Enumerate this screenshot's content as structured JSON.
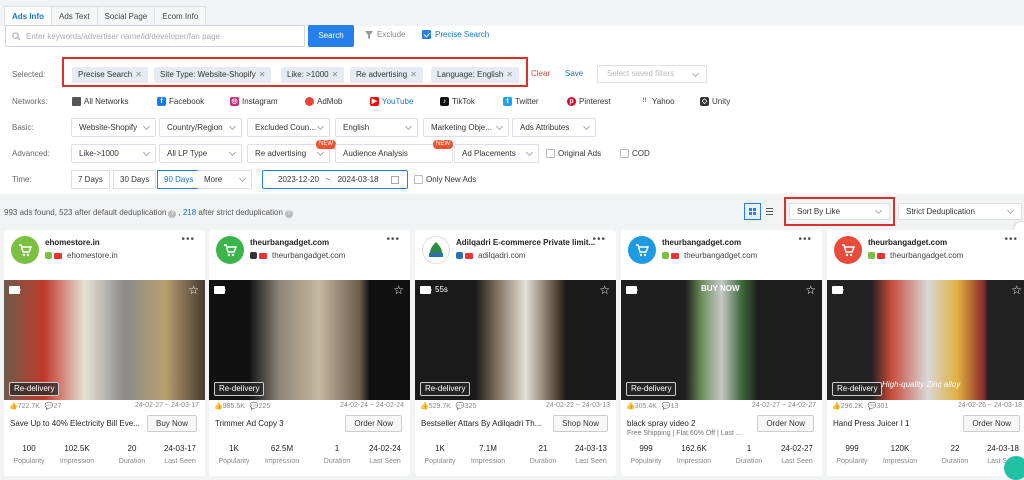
{
  "tabs": [
    "Ads Info",
    "Ads Text",
    "Social Page",
    "Ecom Info"
  ],
  "search": {
    "placeholder": "Enter keywords/advertiser name/id/developer/fan page",
    "button": "Search",
    "exclude": "Exclude",
    "precise": "Precise Search"
  },
  "selected": {
    "label": "Selected:",
    "chips": [
      "Precise Search",
      "Site Type: Website-Shopify",
      "Like: >1000",
      "Re advertising",
      "Language: English"
    ],
    "clear": "Clear",
    "save": "Save",
    "saved_placeholder": "Select saved filters"
  },
  "networks": {
    "label": "Networks:",
    "items": [
      "All Networks",
      "Facebook",
      "Instagram",
      "AdMob",
      "YouTube",
      "TikTok",
      "Twitter",
      "Pinterest",
      "Yahoo",
      "Unity"
    ]
  },
  "basic": {
    "label": "Basic:",
    "items": [
      "Website-Shopify",
      "Country/Region",
      "Excluded Coun...",
      "English",
      "Marketing Obje...",
      "Ads Attributes"
    ]
  },
  "advanced": {
    "label": "Advanced:",
    "items": [
      "Like->1000",
      "All LP Type",
      "Re advertising",
      "Audience Analysis",
      "Ad Placements"
    ],
    "new_badge": "NEW",
    "original_ads": "Original Ads",
    "cod": "COD"
  },
  "time": {
    "label": "Time:",
    "buttons": [
      "7 Days",
      "30 Days",
      "90 Days"
    ],
    "more": "More",
    "start": "2023-12-20",
    "sep": "~",
    "end": "2024-03-18",
    "only_new": "Only New Ads"
  },
  "results": {
    "found": "993 ads found, 523 after default deduplication",
    "sep": ",",
    "strict_count": "218",
    "strict_text": "after strict deduplication",
    "sort": "Sort By Like",
    "dedup": "Strict Deduplication"
  },
  "cards": [
    {
      "name": "ehomestore.in",
      "sub": "ehomestore.in",
      "color": "#7bc043",
      "duration_badge": "",
      "likes": "722.7K",
      "comments": "27",
      "dates": "24-02-27 ~ 24-03-17",
      "title": "Save Up to 40% Electricity Bill Eve...",
      "title2": "",
      "cta": "Buy Now",
      "stats": [
        "100",
        "102.5K",
        "20",
        "24-03-17"
      ],
      "redelivery": "Re-delivery"
    },
    {
      "name": "theurbangadget.com",
      "sub": "theurbangadget.com",
      "color": "#3bb54a",
      "duration_badge": "",
      "likes": "985.5K",
      "comments": "225",
      "dates": "24-02-24 ~ 24-02-24",
      "title": "Trimmer Ad Copy 3",
      "title2": "",
      "cta": "Order Now",
      "stats": [
        "1K",
        "62.5M",
        "1",
        "24-02-24"
      ],
      "redelivery": "Re-delivery"
    },
    {
      "name": "Adilqadri E-commerce Private limit...",
      "sub": "adilqadri.com",
      "color": "#ffffff",
      "duration_badge": "55s",
      "likes": "529.7K",
      "comments": "325",
      "dates": "24-02-22 ~ 24-03-13",
      "title": "Bestseller Attars By Adilqadri Th...",
      "title2": "",
      "cta": "Shop Now",
      "stats": [
        "1K",
        "7.1M",
        "21",
        "24-03-13"
      ],
      "redelivery": "Re-delivery"
    },
    {
      "name": "theurbangadget.com",
      "sub": "theurbangadget.com",
      "color": "#1e9ae0",
      "duration_badge": "",
      "likes": "305.4K",
      "comments": "13",
      "dates": "24-02-27 ~ 24-02-27",
      "title": "black spray video 2",
      "title2": "Free Shipping | Flat 60% Off | Last ...",
      "cta": "Order Now",
      "stats": [
        "999",
        "162.6K",
        "1",
        "24-02-27"
      ],
      "redelivery": "Re-delivery"
    },
    {
      "name": "theurbangadget.com",
      "sub": "theurbangadget.com",
      "color": "#e84a3c",
      "duration_badge": "",
      "likes": "296.2K",
      "comments": "301",
      "dates": "24-02-26 ~ 24-03-18",
      "title": "Hand Press Juicer I 1",
      "title2": "",
      "cta": "Order Now",
      "stats": [
        "999",
        "120K",
        "22",
        "24-03-18"
      ],
      "redelivery": "Re-delivery"
    }
  ],
  "stat_labels": [
    "Popularity",
    "Impression",
    "Duration",
    "Last Seen"
  ],
  "media_text": {
    "buy_now": "BUY NOW",
    "fruit_caption": "High-quality Zinc alloy"
  }
}
